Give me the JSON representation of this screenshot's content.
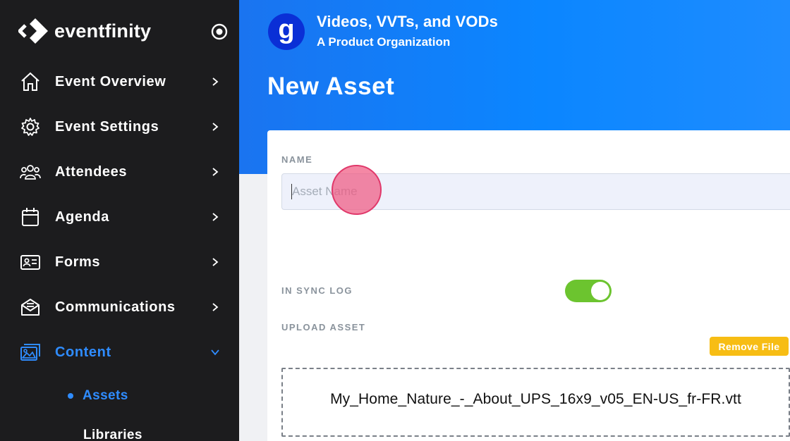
{
  "brand": {
    "name": "eventfinity"
  },
  "sidebar": {
    "items": [
      {
        "label": "Event Overview",
        "icon": "home-icon"
      },
      {
        "label": "Event Settings",
        "icon": "gear-icon"
      },
      {
        "label": "Attendees",
        "icon": "users-icon"
      },
      {
        "label": "Agenda",
        "icon": "calendar-icon"
      },
      {
        "label": "Forms",
        "icon": "id-card-icon"
      },
      {
        "label": "Communications",
        "icon": "mail-icon"
      },
      {
        "label": "Content",
        "icon": "images-icon",
        "active": true,
        "expanded": true
      }
    ],
    "sub_items": [
      {
        "label": "Assets",
        "active": true
      },
      {
        "label": "Libraries"
      }
    ]
  },
  "org": {
    "initial": "g",
    "name": "Videos, VVTs, and VODs",
    "subtitle": "A Product Organization"
  },
  "page": {
    "title": "New Asset"
  },
  "form": {
    "name_label": "NAME",
    "name_placeholder": "Asset Name",
    "name_value": "",
    "sync_label": "IN SYNC LOG",
    "sync_enabled": true,
    "upload_label": "UPLOAD ASSET",
    "remove_label": "Remove File",
    "file_name": "My_Home_Nature_-_About_UPS_16x9_v05_EN-US_fr-FR.vtt"
  },
  "colors": {
    "sidebar_bg": "#1c1c1e",
    "accent": "#2f8cff",
    "hero": "#0b86ff",
    "toggle_on": "#6cc42f",
    "warning": "#f7bd14"
  }
}
